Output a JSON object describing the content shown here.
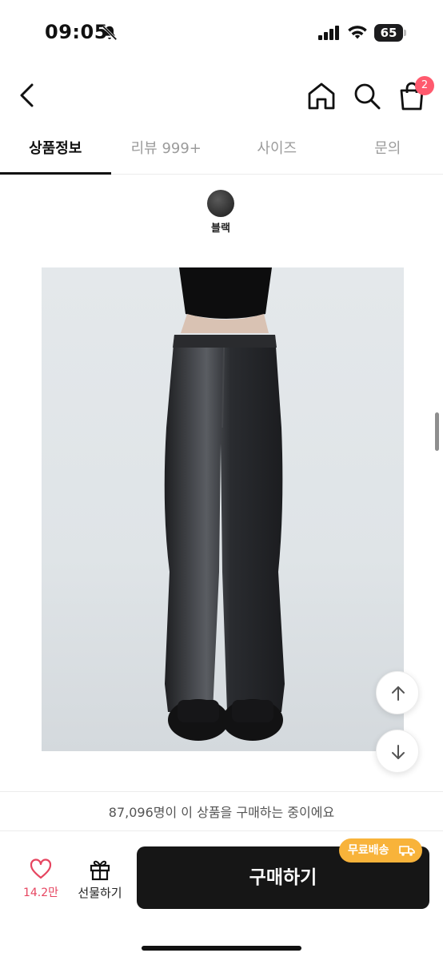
{
  "status_bar": {
    "time": "09:05",
    "battery": "65"
  },
  "header": {
    "cart_count": "2",
    "icons": [
      "back-icon",
      "home-icon",
      "search-icon",
      "shopping-bag-icon"
    ]
  },
  "tabs": [
    {
      "label": "상품정보",
      "active": true
    },
    {
      "label": "리뷰 999+",
      "active": false
    },
    {
      "label": "사이즈",
      "active": false
    },
    {
      "label": "문의",
      "active": false
    }
  ],
  "color_option": {
    "label": "블랙",
    "swatch_color": "#2a2a2a"
  },
  "footer": {
    "buyers_text": "87,096명이 이 상품을 구매하는 중이에요",
    "like_count": "14.2만",
    "gift_label": "선물하기",
    "buy_label": "구매하기",
    "free_shipping_label": "무료배송"
  },
  "colors": {
    "accent_pink": "#ff5a6e",
    "like_pink": "#e64560",
    "buy_button": "#161616",
    "free_shipping": "#f8b33a"
  }
}
